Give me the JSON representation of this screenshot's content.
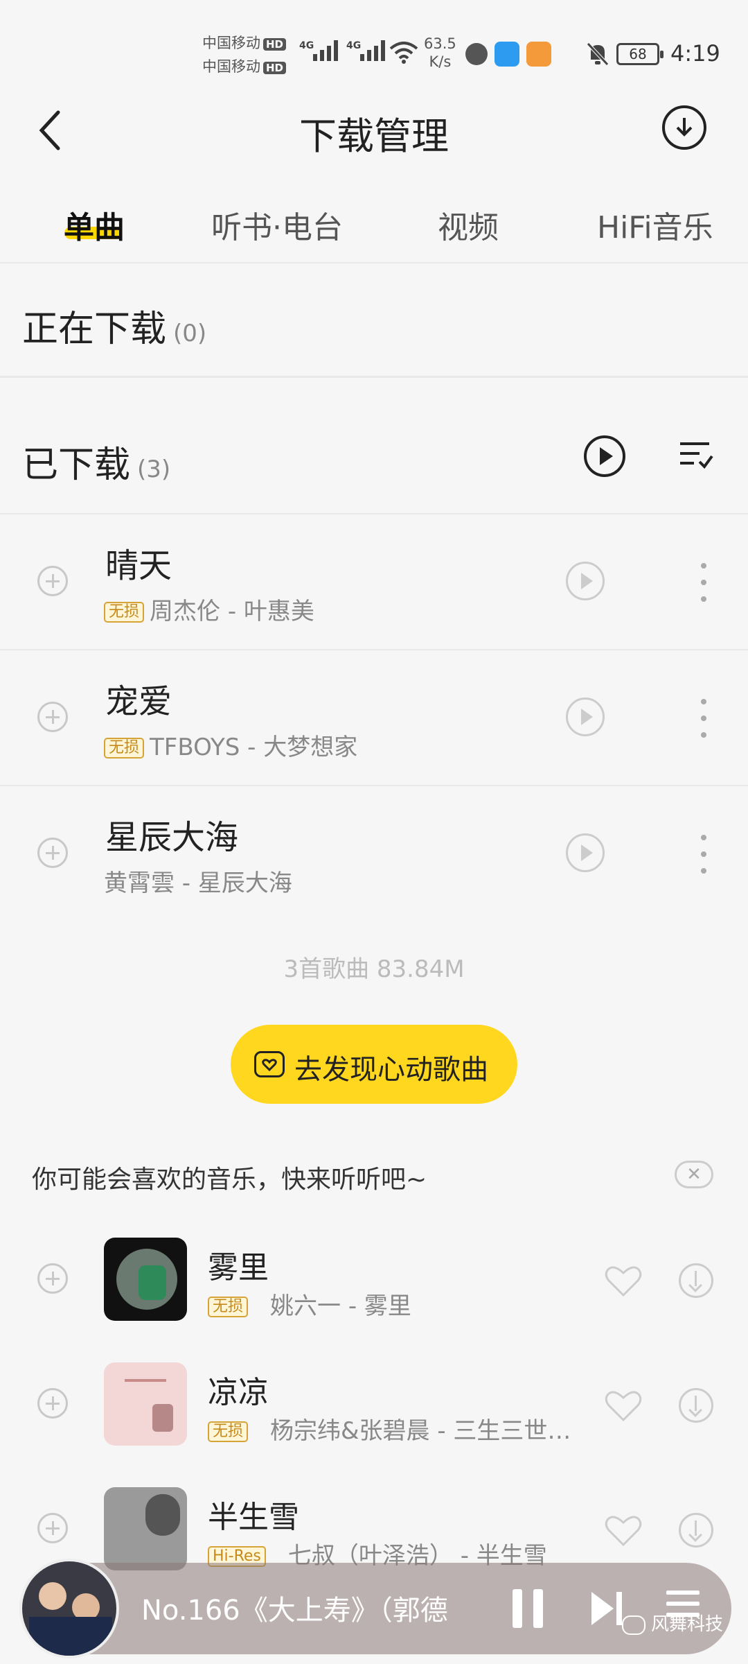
{
  "status_bar": {
    "carrier1": "中国移动",
    "carrier2": "中国移动",
    "hd": "HD",
    "net_type1": "4G",
    "net_type2": "4G",
    "speed_value": "63.5",
    "speed_unit": "K/s",
    "battery": "68",
    "time": "4:19"
  },
  "header": {
    "title": "下载管理"
  },
  "tabs": [
    {
      "label": "单曲"
    },
    {
      "label": "听书·电台"
    },
    {
      "label": "视频"
    },
    {
      "label": "HiFi音乐"
    }
  ],
  "downloading": {
    "label": "正在下载",
    "count": "(0)"
  },
  "downloaded": {
    "label": "已下载",
    "count": "(3)",
    "songs": [
      {
        "title": "晴天",
        "badge": "无损",
        "subtitle": "周杰伦 - 叶惠美"
      },
      {
        "title": "宠爱",
        "badge": "无损",
        "subtitle": "TFBOYS - 大梦想家"
      },
      {
        "title": "星辰大海",
        "badge": "",
        "subtitle": "黄霄雲 - 星辰大海"
      }
    ],
    "summary": "3首歌曲 83.84M"
  },
  "discover_button": {
    "label": "去发现心动歌曲"
  },
  "recommend": {
    "header": "你可能会喜欢的音乐，快来听听吧~",
    "items": [
      {
        "title": "雾里",
        "badge": "无损",
        "subtitle": "姚六一 - 雾里"
      },
      {
        "title": "凉凉",
        "badge": "无损",
        "subtitle": "杨宗纬&张碧晨 - 三生三世…"
      },
      {
        "title": "半生雪",
        "badge": "Hi-Res",
        "subtitle": "七叔（叶泽浩） - 半生雪"
      }
    ]
  },
  "player": {
    "now_playing": "No.166《大上寿》（郭德"
  },
  "watermark": "风舞科技",
  "colors": {
    "accent": "#ffd71f",
    "badge": "#c68a1a"
  }
}
